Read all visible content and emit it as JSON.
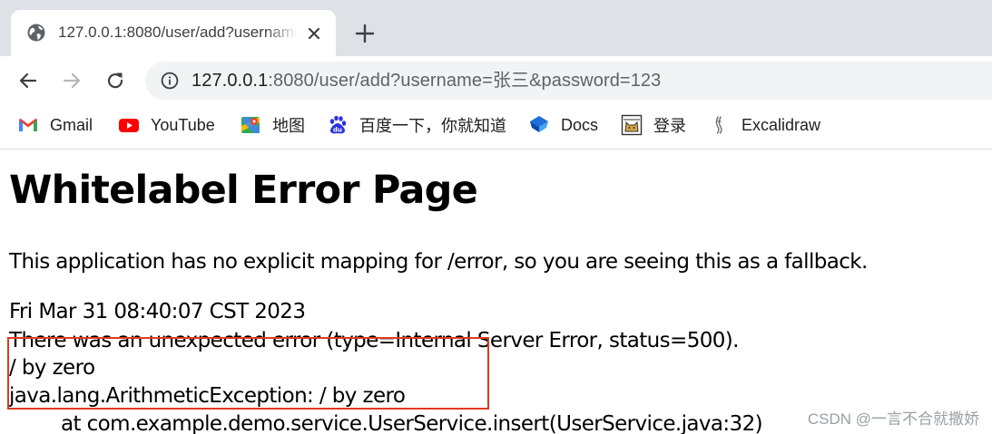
{
  "tab": {
    "title": "127.0.0.1:8080/user/add?username=张三&password=123",
    "favicon": "globe-icon",
    "close_icon": "close-icon"
  },
  "new_tab_icon": "plus-icon",
  "toolbar": {
    "back_icon": "arrow-left-icon",
    "forward_icon": "arrow-right-icon",
    "reload_icon": "reload-icon",
    "site_info_icon": "info-icon",
    "url_host": "127.0.0.1",
    "url_rest": ":8080/user/add?username=张三&password=123"
  },
  "bookmarks": [
    {
      "label": "Gmail",
      "icon": "gmail-icon"
    },
    {
      "label": "YouTube",
      "icon": "youtube-icon"
    },
    {
      "label": "地图",
      "icon": "maps-icon"
    },
    {
      "label": "百度一下，你就知道",
      "icon": "baidu-icon"
    },
    {
      "label": "Docs",
      "icon": "docs-icon"
    },
    {
      "label": "登录",
      "icon": "tomcat-icon"
    },
    {
      "label": "Excalidraw",
      "icon": "excalidraw-icon"
    }
  ],
  "page": {
    "title": "Whitelabel Error Page",
    "explanation": "This application has no explicit mapping for /error, so you are seeing this as a fallback.",
    "timestamp": "Fri Mar 31 08:40:07 CST 2023",
    "error_line": "There was an unexpected error (type=Internal Server Error, status=500).",
    "message": "/ by zero",
    "exception": "java.lang.ArithmeticException: / by zero",
    "stack_line": "at com.example.demo.service.UserService.insert(UserService.java:32)"
  },
  "watermark": "CSDN @一言不合就撒娇",
  "colors": {
    "highlight_box": "#e03a1f",
    "tabstrip_bg": "#dee1e6",
    "omnibox_bg": "#f1f3f4"
  }
}
